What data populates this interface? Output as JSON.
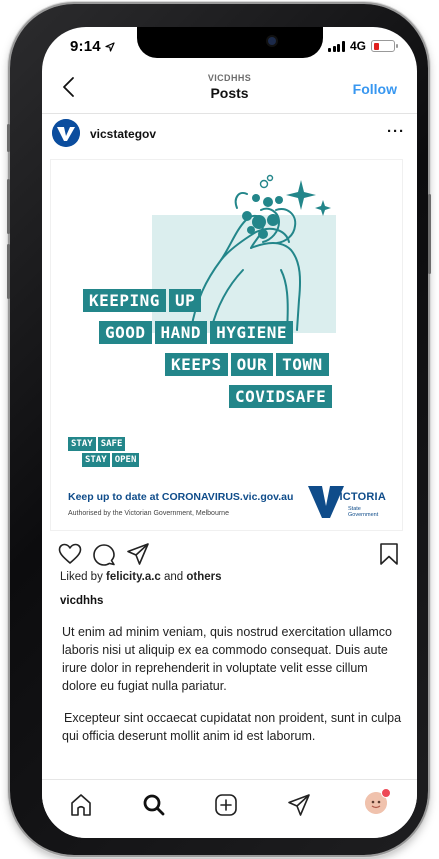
{
  "status_bar": {
    "time": "9:14",
    "network": "4G"
  },
  "header": {
    "username": "VICDHHS",
    "title": "Posts",
    "follow_label": "Follow"
  },
  "account": {
    "handle": "vicstategov"
  },
  "post": {
    "headline": [
      "KEEPING",
      "UP",
      "GOOD",
      "HAND",
      "HYGIENE",
      "KEEPS",
      "OUR",
      "TOWN",
      "COVIDSAFE"
    ],
    "stay": [
      "STAY",
      "SAFE",
      "STAY",
      "OPEN"
    ],
    "cta": "Keep up to date at CORONAVIRUS.vic.gov.au",
    "authorised": "Authorised by the Victorian Government, Melbourne",
    "logo": {
      "name": "VICTORIA",
      "line1": "State",
      "line2": "Government"
    }
  },
  "likes": {
    "prefix": "Liked by",
    "user": "felicity.a.c",
    "joiner": "and",
    "others": "others"
  },
  "caption": {
    "user": "vicdhhs",
    "paragraphs": [
      "Ut enim ad minim veniam, quis nostrud exercitation ullamco laboris nisi ut aliquip ex ea commodo consequat. Duis aute irure dolor in reprehenderit in voluptate velit esse cillum dolore eu fugiat nulla pariatur.",
      "Excepteur sint occaecat cupidatat non proident, sunt in culpa qui officia deserunt mollit anim id est laborum."
    ]
  },
  "colors": {
    "teal": "#23868a",
    "navy": "#0f4c8a",
    "link": "#3897f0",
    "battery": "#e0201f"
  },
  "icons": [
    "back-chevron-icon",
    "heart-icon",
    "comment-icon",
    "share-icon",
    "bookmark-icon",
    "home-icon",
    "search-icon",
    "add-post-icon",
    "activity-icon"
  ]
}
